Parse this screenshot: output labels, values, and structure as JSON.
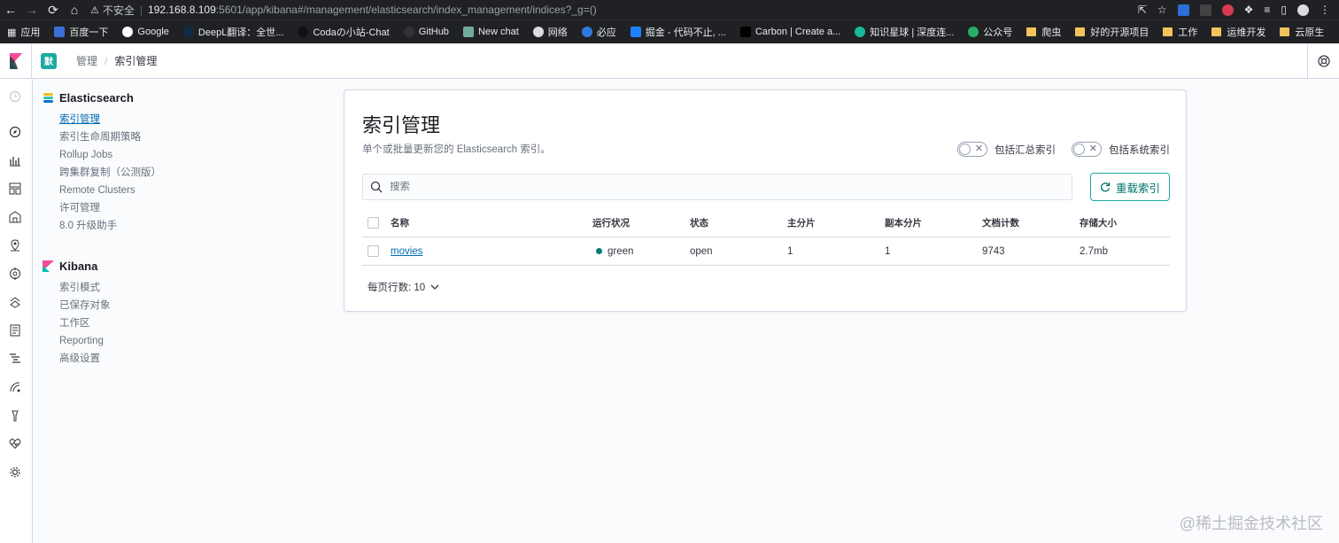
{
  "browser": {
    "insecure_label": "不安全",
    "url_host": "192.168.8.109",
    "url_path": ":5601/app/kibana#/management/elasticsearch/index_management/indices?_g=()",
    "bookmarks": [
      {
        "label": "应用",
        "kind": "apps"
      },
      {
        "label": "百度一下",
        "kind": "site"
      },
      {
        "label": "Google",
        "kind": "site"
      },
      {
        "label": "DeepL翻译：全世...",
        "kind": "site"
      },
      {
        "label": "Codaの小站-Chat",
        "kind": "site"
      },
      {
        "label": "GitHub",
        "kind": "site"
      },
      {
        "label": "New chat",
        "kind": "site"
      },
      {
        "label": "网络",
        "kind": "site"
      },
      {
        "label": "必应",
        "kind": "site"
      },
      {
        "label": "掘金 - 代码不止, ...",
        "kind": "site"
      },
      {
        "label": "Carbon | Create a...",
        "kind": "site"
      },
      {
        "label": "知识星球 | 深度连...",
        "kind": "site"
      },
      {
        "label": "公众号",
        "kind": "site"
      },
      {
        "label": "爬虫",
        "kind": "folder"
      },
      {
        "label": "好的开源项目",
        "kind": "folder"
      },
      {
        "label": "工作",
        "kind": "folder"
      },
      {
        "label": "运维开发",
        "kind": "folder"
      },
      {
        "label": "云原生",
        "kind": "folder"
      }
    ]
  },
  "header": {
    "space_initial": "默",
    "breadcrumb_root": "管理",
    "breadcrumb_current": "索引管理"
  },
  "sidenav": {
    "elasticsearch_title": "Elasticsearch",
    "elasticsearch_items": [
      "索引管理",
      "索引生命周期策略",
      "Rollup Jobs",
      "跨集群复制（公测版）",
      "Remote Clusters",
      "许可管理",
      "8.0 升级助手"
    ],
    "kibana_title": "Kibana",
    "kibana_items": [
      "索引模式",
      "已保存对象",
      "工作区",
      "Reporting",
      "高级设置"
    ]
  },
  "main": {
    "title": "索引管理",
    "description": "单个或批量更新您的 Elasticsearch 索引。",
    "toggle_rollup_label": "包括汇总索引",
    "toggle_system_label": "包括系统索引",
    "search_placeholder": "搜索",
    "reload_label": "重载索引",
    "columns": {
      "name": "名称",
      "health": "运行状况",
      "status": "状态",
      "primary": "主分片",
      "replicas": "副本分片",
      "docs": "文档计数",
      "size": "存储大小"
    },
    "rows": [
      {
        "name": "movies",
        "health": "green",
        "status": "open",
        "primary": "1",
        "replicas": "1",
        "docs": "9743",
        "size": "2.7mb"
      }
    ],
    "rows_per_page": "每页行数: 10"
  },
  "colors": {
    "accent": "#006bb4",
    "health_green": "#017d73",
    "button_border": "#1ba9a0"
  },
  "watermark": "@稀土掘金技术社区"
}
